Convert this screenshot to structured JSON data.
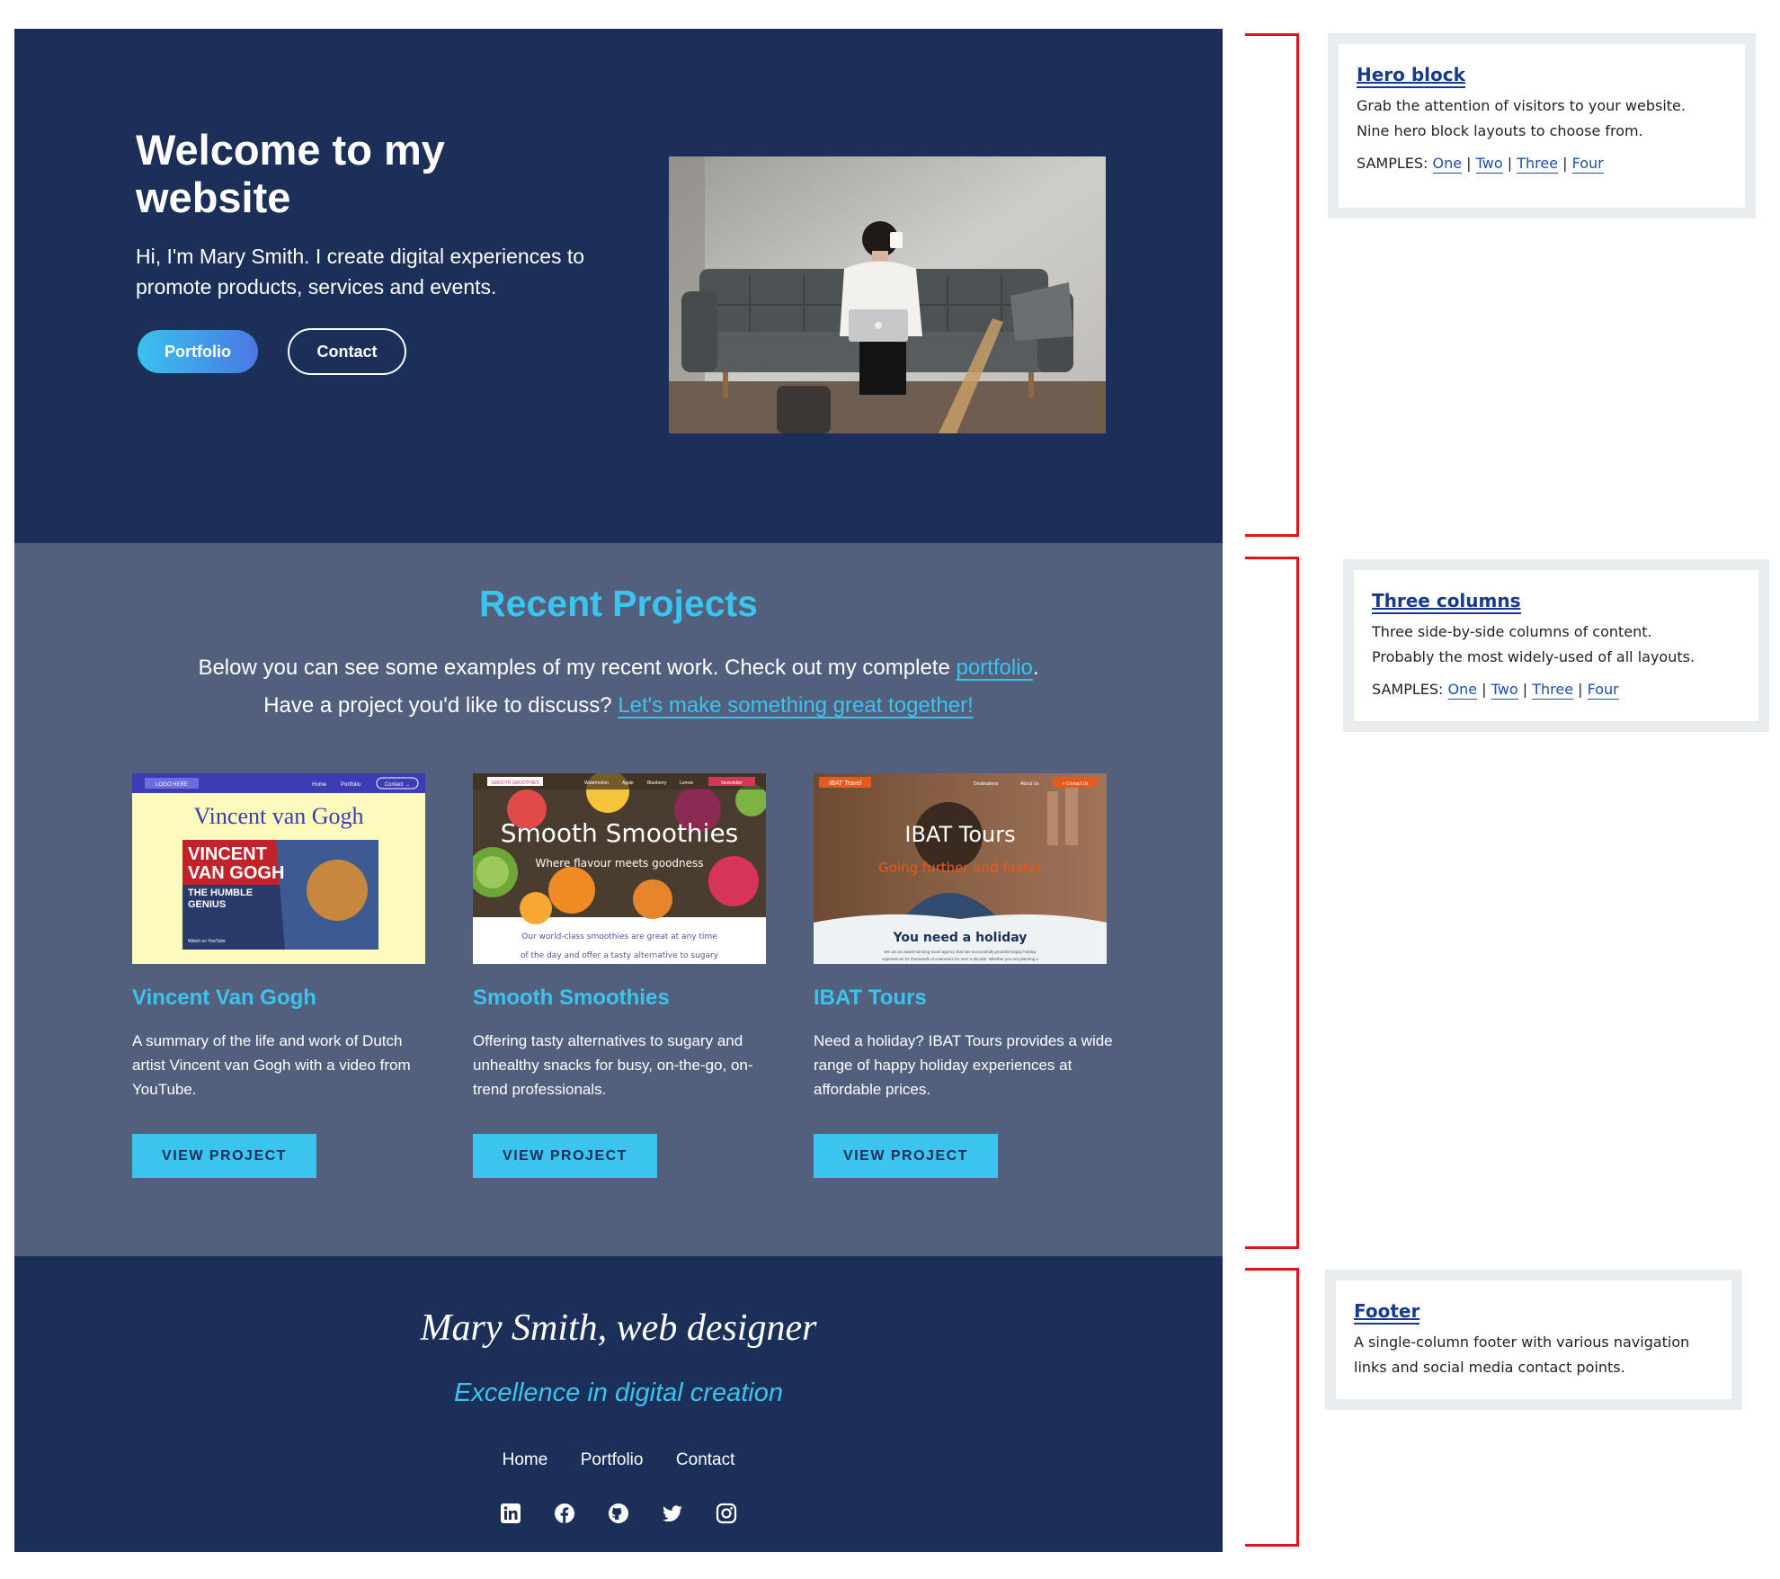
{
  "hero": {
    "heading": "Welcome to my website",
    "lead": "Hi, I'm Mary Smith. I create digital experiences to promote products, services and events.",
    "portfolio_label": "Portfolio",
    "contact_label": "Contact"
  },
  "projects": {
    "heading": "Recent Projects",
    "intro_before": "Below you can see some examples of my recent work. Check out my complete ",
    "intro_link1": "portfolio",
    "intro_mid": ". Have a project you'd like to discuss? ",
    "intro_link2": "Let's make something great together!",
    "cards": [
      {
        "title": "Vincent Van Gogh",
        "description": "A summary of the life and work of Dutch artist Vincent van Gogh with a video from YouTube.",
        "button": "VIEW PROJECT",
        "thumb": {
          "logo": "LOGO HERE",
          "nav": [
            "Home",
            "Portfolio"
          ],
          "cta": "Contact →",
          "title": "Vincent van Gogh",
          "video_line1": "VINCENT",
          "video_line2": "VAN GOGH",
          "video_line3": "THE HUMBLE",
          "video_line4": "GENIUS",
          "video_caption": "Watch on YouTube"
        }
      },
      {
        "title": "Smooth Smoothies",
        "description": "Offering tasty alternatives to sugary and unhealthy snacks for busy, on-the-go, on-trend professionals.",
        "button": "VIEW PROJECT",
        "thumb": {
          "logo": "SMOOTH SMOOTHIES",
          "nav": [
            "Watermelon",
            "Apple",
            "Blueberry",
            "Lemon"
          ],
          "cta": "Newsletter",
          "title": "Smooth Smoothies",
          "subtitle": "Where flavour meets goodness",
          "body_line1": "Our world-class smoothies are great at any time",
          "body_line2": "of the day and offer a tasty alternative to sugary"
        }
      },
      {
        "title": "IBAT Tours",
        "description": "Need a holiday? IBAT Tours provides a wide range of happy holiday experiences at affordable prices.",
        "button": "VIEW PROJECT",
        "thumb": {
          "logo": "IBAT Travel",
          "nav": [
            "Destinations",
            "About Us"
          ],
          "cta": "+ Contact Us",
          "title": "IBAT Tours",
          "subtitle": "Going further and faster",
          "band_title": "You need a holiday",
          "band_line1": "We are an award-winning travel agency that has successfully provided happy holiday",
          "band_line2": "experiences for thousands of customers for over a decade. Whether you are planning a"
        }
      }
    ]
  },
  "footer": {
    "signature": "Mary Smith, web designer",
    "tagline": "Excellence in digital creation",
    "nav": [
      "Home",
      "Portfolio",
      "Contact"
    ],
    "social_icons": [
      "linkedin-icon",
      "facebook-icon",
      "github-icon",
      "twitter-icon",
      "instagram-icon"
    ]
  },
  "annotations": {
    "hero": {
      "title": "Hero block",
      "line1": "Grab the attention of visitors to your website.",
      "line2": "Nine hero block layouts to choose from.",
      "samples_label": "SAMPLES:",
      "samples": [
        "One",
        "Two",
        "Three",
        "Four"
      ]
    },
    "columns": {
      "title": "Three columns",
      "line1": "Three side-by-side columns of content.",
      "line2": "Probably the most widely-used of all layouts.",
      "samples_label": "SAMPLES:",
      "samples": [
        "One",
        "Two",
        "Three",
        "Four"
      ]
    },
    "footer": {
      "title": "Footer",
      "line1": "A single-column footer with various navigation",
      "line2": "links and social media contact points."
    }
  },
  "colors": {
    "navy": "#1b2f58",
    "slate": "#52607e",
    "cyan": "#3ac4ee",
    "bracket_red": "#e3131d",
    "annotation_link": "#173a8e"
  }
}
